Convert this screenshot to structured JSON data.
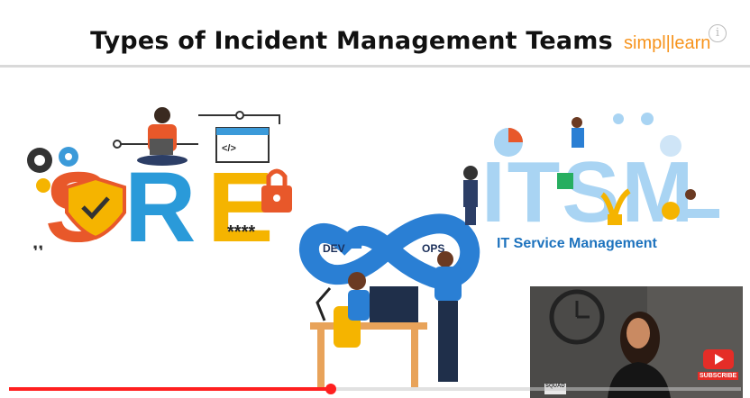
{
  "slide": {
    "title": "Types of Incident Management Teams",
    "brand_prefix": "simpl",
    "brand_suffix": "learn",
    "info_label": "i"
  },
  "sre": {
    "letters": "SRE",
    "password_mask": "****",
    "code_glyph": "</>"
  },
  "devops": {
    "left": "DEV",
    "right": "OPS"
  },
  "itsm": {
    "letters": "ITSM",
    "subtitle": "IT Service Management"
  },
  "presenter": {
    "subscribe_label": "SUBSCRIBE",
    "mic_label": "SQUAD"
  },
  "player": {
    "progress": 0.44
  },
  "colors": {
    "accent_red": "#ff1f1f",
    "brand_orange": "#f7941d",
    "itsm_blue": "#1e73be"
  }
}
